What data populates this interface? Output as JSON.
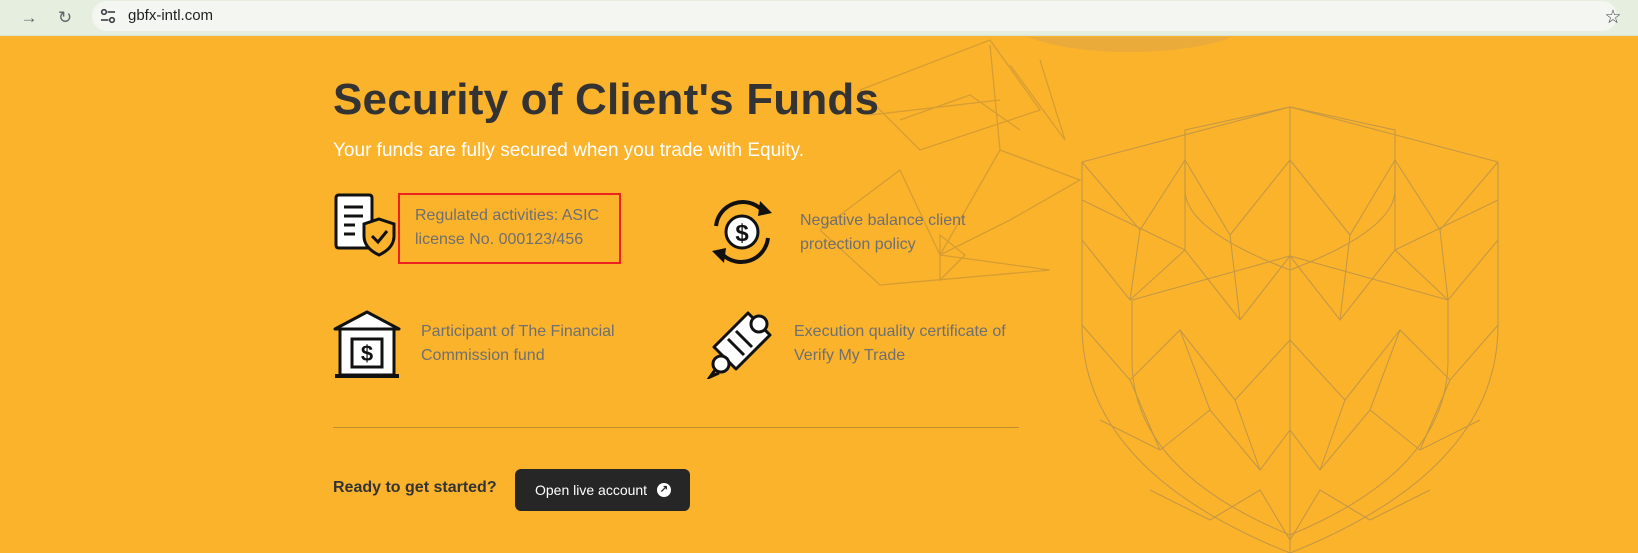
{
  "browser": {
    "url": "gbfx-intl.com",
    "forward_icon": "→",
    "reload_icon": "↻",
    "star_icon": "☆"
  },
  "page": {
    "title": "Security of Client's Funds",
    "subtitle": "Your funds are fully secured when you trade with Equity.",
    "features": [
      {
        "line1": "Regulated activities: ASIC",
        "line2": "license No. 000123/456",
        "icon": "document-shield-icon"
      },
      {
        "line1": "Negative balance client",
        "line2": "protection policy",
        "icon": "dollar-cycle-icon"
      },
      {
        "line1": "Participant of The Financial",
        "line2": "Commission fund",
        "icon": "bank-vault-icon"
      },
      {
        "line1": "Execution quality certificate of",
        "line2": "Verify My Trade",
        "icon": "certificate-scroll-icon"
      }
    ],
    "cta": {
      "prompt": "Ready to get started?",
      "button_label": "Open live account",
      "button_icon": "↗"
    }
  },
  "colors": {
    "background": "#fbb32c",
    "title": "#333333",
    "feature_text": "#6f6f6f",
    "button": "#262626",
    "highlight": "#ee2121"
  }
}
